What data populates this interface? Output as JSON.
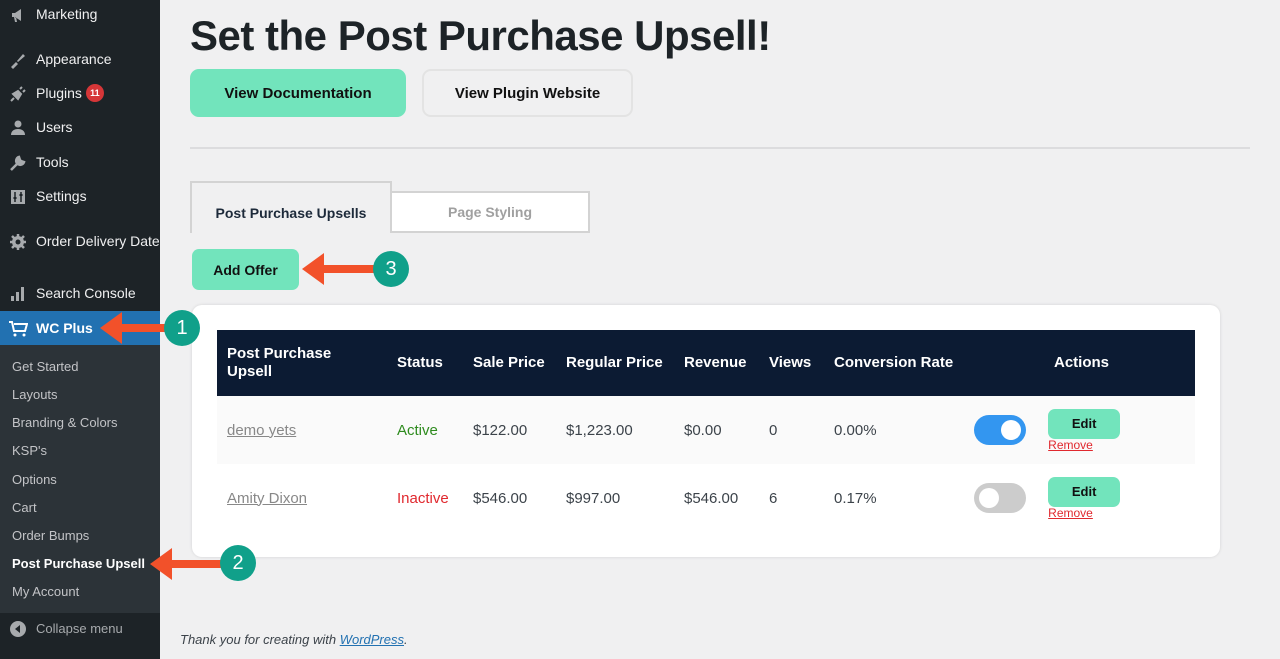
{
  "sidebar": {
    "items": [
      {
        "label": "Marketing",
        "icon": "megaphone-icon"
      },
      {
        "label": "Appearance",
        "icon": "paintbrush-icon"
      },
      {
        "label": "Plugins",
        "icon": "plugin-icon",
        "badge": "11"
      },
      {
        "label": "Users",
        "icon": "user-icon"
      },
      {
        "label": "Tools",
        "icon": "wrench-icon"
      },
      {
        "label": "Settings",
        "icon": "settings-sliders-icon"
      },
      {
        "label": "Order Delivery Date",
        "icon": "gear-icon"
      },
      {
        "label": "Search Console",
        "icon": "bar-chart-icon"
      },
      {
        "label": "WC Plus",
        "icon": "cart-icon"
      }
    ],
    "submenu": [
      "Get Started",
      "Layouts",
      "Branding & Colors",
      "KSP's",
      "Options",
      "Cart",
      "Order Bumps",
      "Post Purchase Upsell",
      "My Account"
    ],
    "collapse_label": "Collapse menu"
  },
  "main": {
    "title": "Set the Post Purchase Upsell!",
    "view_docs_label": "View Documentation",
    "view_site_label": "View Plugin Website",
    "tabs": [
      {
        "label": "Post Purchase Upsells",
        "active": true
      },
      {
        "label": "Page Styling",
        "active": false
      }
    ],
    "add_offer_label": "Add Offer",
    "table": {
      "headers": [
        "Post Purchase Upsell",
        "Status",
        "Sale Price",
        "Regular Price",
        "Revenue",
        "Views",
        "Conversion Rate",
        "",
        "Actions"
      ],
      "rows": [
        {
          "name": "demo yets",
          "status": "Active",
          "sale_price": "$122.00",
          "regular_price": "$1,223.00",
          "revenue": "$0.00",
          "views": "0",
          "conversion": "0.00%",
          "enabled": true,
          "edit": "Edit",
          "remove": "Remove"
        },
        {
          "name": "Amity Dixon",
          "status": "Inactive",
          "sale_price": "$546.00",
          "regular_price": "$997.00",
          "revenue": "$546.00",
          "views": "6",
          "conversion": "0.17%",
          "enabled": false,
          "edit": "Edit",
          "remove": "Remove"
        }
      ]
    }
  },
  "footer": {
    "text": "Thank you for creating with ",
    "link": "WordPress",
    "suffix": "."
  },
  "annotations": [
    "1",
    "2",
    "3"
  ],
  "colors": {
    "accent_green": "#72e4bc",
    "header_navy": "#0c1b33",
    "wp_blue": "#2271b1",
    "arrow": "#f2512a",
    "step_badge": "#10a08a"
  }
}
